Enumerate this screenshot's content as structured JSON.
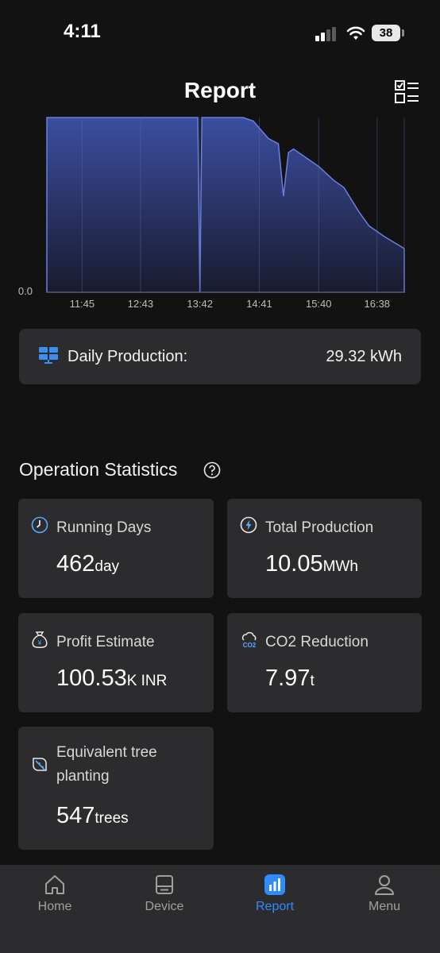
{
  "status_bar": {
    "time": "4:11",
    "battery": "38"
  },
  "header": {
    "title": "Report"
  },
  "chart_data": {
    "type": "area",
    "x_ticks": [
      "11:45",
      "12:43",
      "13:42",
      "14:41",
      "15:40",
      "16:38"
    ],
    "y_tick_label": "0.0",
    "series_color": "#3b4ea0",
    "x": [
      "11:10",
      "13:40",
      "13:42",
      "13:44",
      "14:25",
      "14:35",
      "14:50",
      "15:00",
      "15:05",
      "15:10",
      "15:15",
      "15:25",
      "15:40",
      "15:55",
      "16:05",
      "16:20",
      "16:30",
      "16:45",
      "17:05"
    ],
    "y_rel": [
      1.0,
      1.0,
      0.0,
      1.0,
      1.0,
      0.98,
      0.88,
      0.85,
      0.55,
      0.8,
      0.82,
      0.78,
      0.72,
      0.64,
      0.6,
      0.46,
      0.38,
      0.32,
      0.25
    ]
  },
  "daily": {
    "label": "Daily Production:",
    "value": "29.32 kWh"
  },
  "stats": {
    "title": "Operation Statistics",
    "running_days": {
      "label": "Running Days",
      "value": "462",
      "unit": "day"
    },
    "total_production": {
      "label": "Total Production",
      "value": "10.05",
      "unit": "MWh"
    },
    "profit": {
      "label": "Profit Estimate",
      "value": "100.53",
      "unit": "K INR"
    },
    "co2": {
      "label": "CO2 Reduction",
      "value": "7.97",
      "unit": "t"
    },
    "trees": {
      "label": "Equivalent tree planting",
      "value": "547",
      "unit": "trees"
    }
  },
  "tabbar": {
    "home": "Home",
    "device": "Device",
    "report": "Report",
    "menu": "Menu",
    "active": "report",
    "accent": "#2f8cff"
  }
}
